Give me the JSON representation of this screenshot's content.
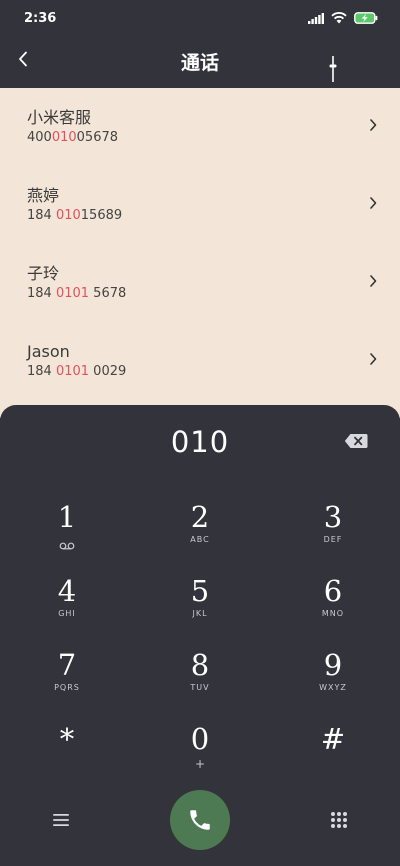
{
  "status_bar": {
    "time": "2:36"
  },
  "header": {
    "title": "通话"
  },
  "results": [
    {
      "name": "小米客服",
      "number_pre": "400",
      "number_match": "010",
      "number_post": "05678"
    },
    {
      "name": "燕婷",
      "number_pre": "184 ",
      "number_match": "010",
      "number_post": "15689"
    },
    {
      "name": "子玲",
      "number_pre": "184 ",
      "number_match": "0101",
      "number_post": " 5678"
    },
    {
      "name": "Jason",
      "number_pre": "184 ",
      "number_match": "0101",
      "number_post": " 0029"
    }
  ],
  "dialpad": {
    "input": "010",
    "keys": [
      {
        "digit": "1",
        "letters": ""
      },
      {
        "digit": "2",
        "letters": "ABC"
      },
      {
        "digit": "3",
        "letters": "DEF"
      },
      {
        "digit": "4",
        "letters": "GHI"
      },
      {
        "digit": "5",
        "letters": "JKL"
      },
      {
        "digit": "6",
        "letters": "MNO"
      },
      {
        "digit": "7",
        "letters": "PQRS"
      },
      {
        "digit": "8",
        "letters": "TUV"
      },
      {
        "digit": "9",
        "letters": "WXYZ"
      },
      {
        "digit": "*",
        "letters": ""
      },
      {
        "digit": "0",
        "letters": "+"
      },
      {
        "digit": "#",
        "letters": ""
      }
    ]
  },
  "colors": {
    "background": "#33333b",
    "results_bg": "#f3e6d8",
    "highlight": "#e5505d",
    "call_button": "#4e7a53"
  }
}
